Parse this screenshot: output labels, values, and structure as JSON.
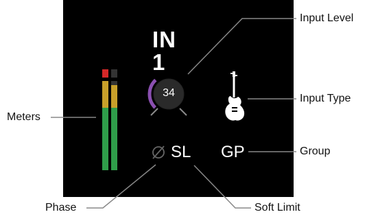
{
  "title": "IN 1",
  "input_level": {
    "value": "34",
    "fraction": 0.34
  },
  "soft_limit_label": "SL",
  "group_label": "GP",
  "callouts": {
    "input_level": "Input Level",
    "input_type": "Input Type",
    "group": "Group",
    "meters": "Meters",
    "phase": "Phase",
    "soft_limit": "Soft Limit"
  },
  "meters": {
    "left": {
      "clip": "on",
      "level": 1.0
    },
    "right": {
      "clip": "off",
      "level": 0.95
    }
  },
  "icons": {
    "phase": "phase-symbol-icon",
    "input_type": "electric-guitar-icon"
  },
  "colors": {
    "panel_background": "#000000",
    "text_primary": "#ffffff",
    "arc_active": "#8a4fb0",
    "meter_green": "#2f9e4a",
    "meter_yellow": "#c8a02a",
    "meter_red": "#d62828",
    "meter_off": "#333333",
    "phase_icon_dim": "#666666",
    "callout_line": "#888888",
    "callout_text": "#111111"
  }
}
